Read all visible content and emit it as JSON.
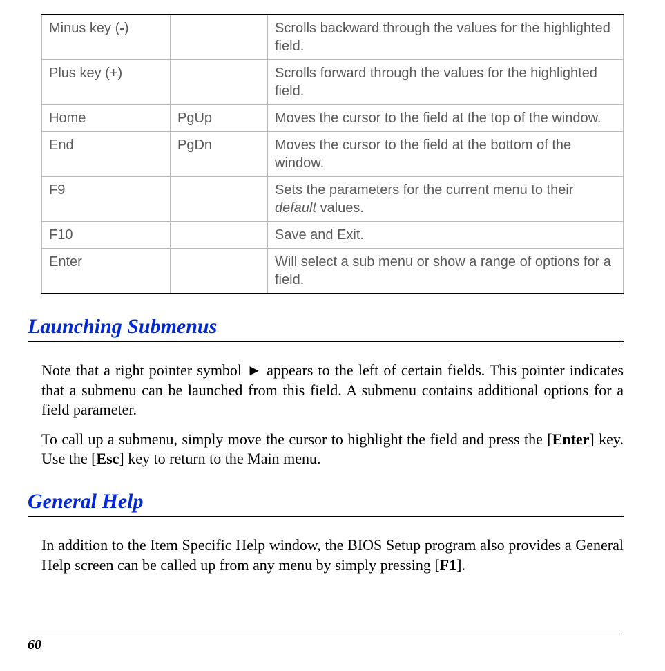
{
  "table": {
    "rows": [
      {
        "col1_pre": "Minus key (",
        "col1_bold": "-",
        "col1_post": ")",
        "col2": "",
        "col3_pre": "Scrolls backward through the values for the highlighted field.",
        "col3_italic": "",
        "col3_post": ""
      },
      {
        "col1_pre": "Plus key (+)",
        "col1_bold": "",
        "col1_post": "",
        "col2": "",
        "col3_pre": "Scrolls forward through the values for the highlighted field.",
        "col3_italic": "",
        "col3_post": ""
      },
      {
        "col1_pre": "Home",
        "col1_bold": "",
        "col1_post": "",
        "col2": "PgUp",
        "col3_pre": "Moves the cursor to the field at the top of the window.",
        "col3_italic": "",
        "col3_post": ""
      },
      {
        "col1_pre": "End",
        "col1_bold": "",
        "col1_post": "",
        "col2": "PgDn",
        "col3_pre": "Moves the cursor to the field at the bottom of the window.",
        "col3_italic": "",
        "col3_post": ""
      },
      {
        "col1_pre": "F9",
        "col1_bold": "",
        "col1_post": "",
        "col2": "",
        "col3_pre": "Sets the parameters for the current menu to their ",
        "col3_italic": "default",
        "col3_post": " values."
      },
      {
        "col1_pre": "F10",
        "col1_bold": "",
        "col1_post": "",
        "col2": "",
        "col3_pre": "Save and Exit.",
        "col3_italic": "",
        "col3_post": ""
      },
      {
        "col1_pre": "Enter",
        "col1_bold": "",
        "col1_post": "",
        "col2": "",
        "col3_pre": "Will select a sub menu or show a range of options for a field.",
        "col3_italic": "",
        "col3_post": ""
      }
    ]
  },
  "section1": {
    "heading": "Launching Submenus",
    "p1_a": "Note that a right pointer symbol ",
    "p1_sym": "►",
    "p1_b": " appears to the left of certain fields.  This pointer indicates that a submenu can be launched from this field.  A submenu contains additional options for a field parameter.",
    "p2_a": "To call up a submenu, simply move the cursor to highlight the field and press the [",
    "p2_k1": "Enter",
    "p2_b": "] key.  Use the [",
    "p2_k2": "Esc",
    "p2_c": "] key to return to the Main menu."
  },
  "section2": {
    "heading": "General Help",
    "p1_a": "In addition to the Item Specific Help window, the BIOS Setup program also provides a General Help screen can be called up from any menu by simply pressing [",
    "p1_k1": "F1",
    "p1_b": "]."
  },
  "footer": {
    "page_number": "60"
  }
}
